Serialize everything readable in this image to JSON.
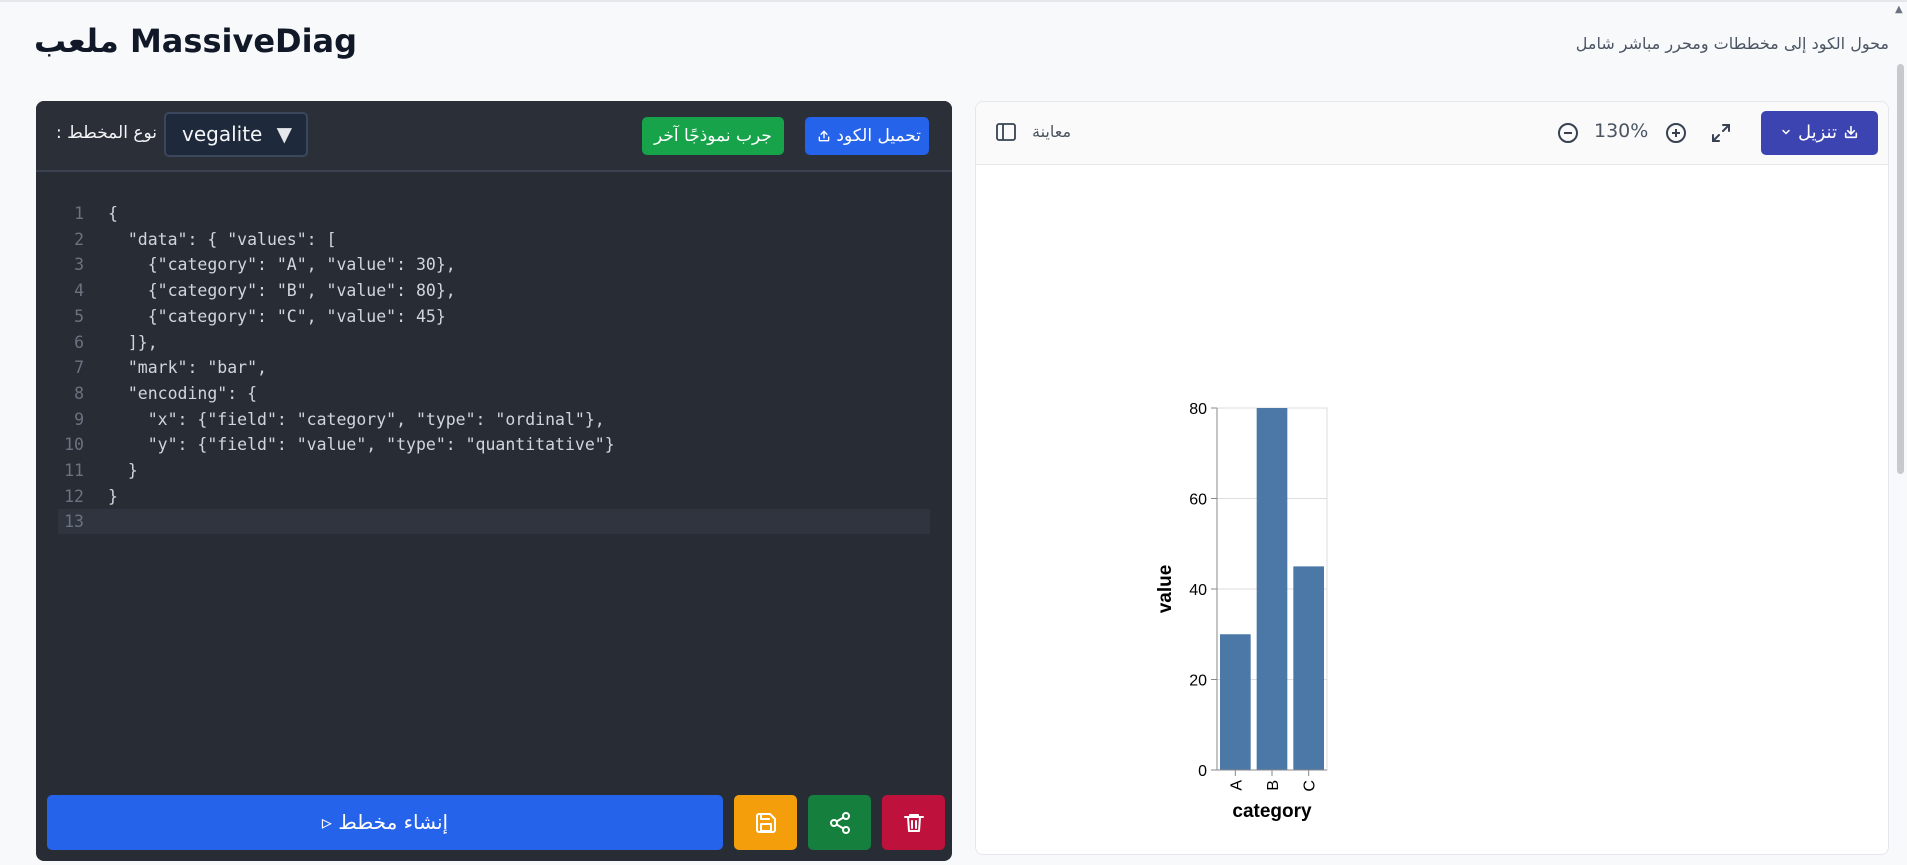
{
  "header": {
    "title": "ملعب MassiveDiag",
    "subtitle": "محول الكود إلى مخططات ومحرر مباشر شامل"
  },
  "editor": {
    "type_label": "نوع المخطط :",
    "type_value": "vegalite",
    "sample_button": "جرب نموذجًا آخر",
    "upload_button": "تحميل الكود",
    "lines": [
      {
        "n": "1",
        "text": "{"
      },
      {
        "n": "2",
        "text": "  \"data\": { \"values\": ["
      },
      {
        "n": "3",
        "text": "    {\"category\": \"A\", \"value\": 30},"
      },
      {
        "n": "4",
        "text": "    {\"category\": \"B\", \"value\": 80},"
      },
      {
        "n": "5",
        "text": "    {\"category\": \"C\", \"value\": 45}"
      },
      {
        "n": "6",
        "text": "  ]},"
      },
      {
        "n": "7",
        "text": "  \"mark\": \"bar\","
      },
      {
        "n": "8",
        "text": "  \"encoding\": {"
      },
      {
        "n": "9",
        "text": "    \"x\": {\"field\": \"category\", \"type\": \"ordinal\"},"
      },
      {
        "n": "10",
        "text": "    \"y\": {\"field\": \"value\", \"type\": \"quantitative\"}"
      },
      {
        "n": "11",
        "text": "  }"
      },
      {
        "n": "12",
        "text": "}"
      },
      {
        "n": "13",
        "text": ""
      }
    ],
    "active_line": 12,
    "generate_button": "إنشاء مخطط ▹"
  },
  "preview": {
    "label": "معاينة",
    "zoom": "130%",
    "download_button": "تنزيل"
  },
  "chart_data": {
    "type": "bar",
    "categories": [
      "A",
      "B",
      "C"
    ],
    "values": [
      30,
      80,
      45
    ],
    "xlabel": "category",
    "ylabel": "value",
    "ylim": [
      0,
      80
    ],
    "yticks": [
      0,
      20,
      40,
      60,
      80
    ],
    "grid": true,
    "color": "#4c78a8"
  }
}
